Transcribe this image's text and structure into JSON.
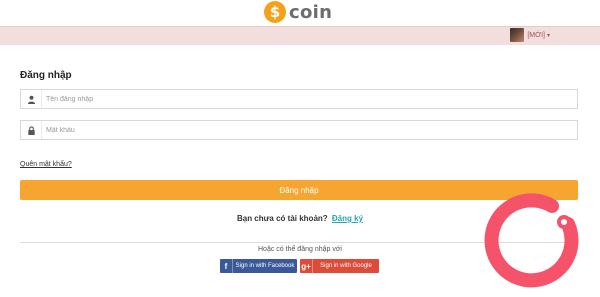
{
  "header": {
    "logo_symbol": "$",
    "logo_text": "coin"
  },
  "topbar": {
    "user_name": "[MỚI]",
    "caret": "▾"
  },
  "login": {
    "title": "Đăng nhập",
    "username_placeholder": "Tên đăng nhập",
    "password_placeholder": "Mật khẩu",
    "forgot_label": "Quên mật khẩu?",
    "submit_label": "Đăng nhập"
  },
  "signup": {
    "question": "Bạn chưa có tài khoản?",
    "link_label": "Đăng ký"
  },
  "social": {
    "divider_text": "Hoặc có thể đăng nhập với",
    "facebook_icon": "f",
    "facebook_label": "Sign in with Facebook",
    "google_icon": "g+",
    "google_label": "Sign in with Google"
  },
  "icons": {
    "user_icon": "user-icon",
    "lock_icon": "lock-icon"
  },
  "colors": {
    "accent": "#f7a531",
    "topbar": "#f3dede",
    "link": "#29a6b3",
    "facebook": "#3b5998",
    "google": "#dd4b39",
    "brand_mark": "#f4536a"
  }
}
